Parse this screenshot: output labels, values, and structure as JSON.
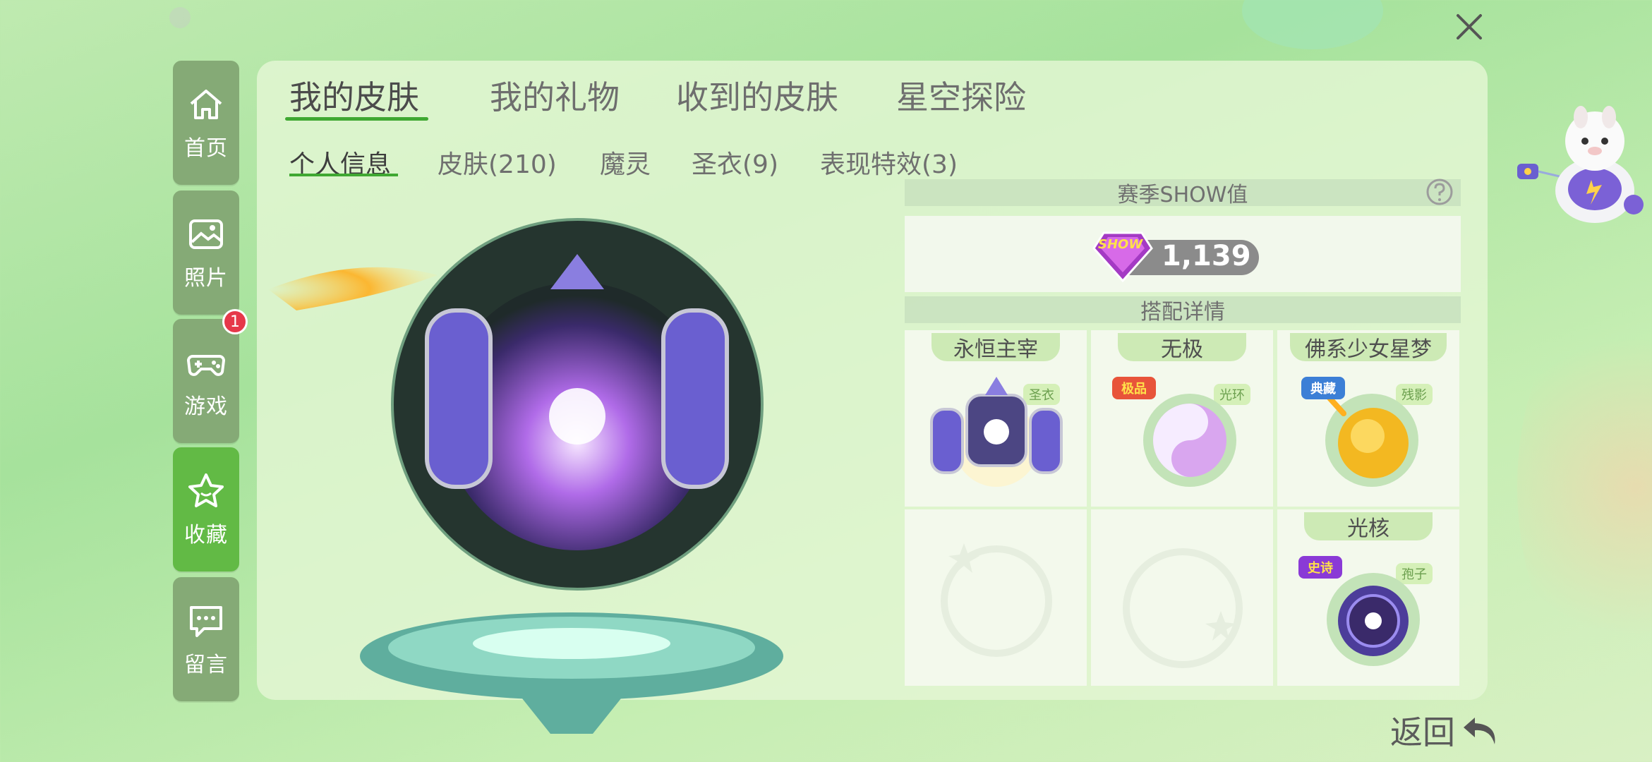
{
  "main_tabs": [
    {
      "label": "我的皮肤"
    },
    {
      "label": "我的礼物"
    },
    {
      "label": "收到的皮肤"
    },
    {
      "label": "星空探险"
    }
  ],
  "sub_tabs": [
    {
      "label": "个人信息"
    },
    {
      "label": "皮肤(210)"
    },
    {
      "label": "魔灵"
    },
    {
      "label": "圣衣(9)"
    },
    {
      "label": "表现特效(3)"
    }
  ],
  "sidebar": {
    "items": [
      {
        "label": "首页",
        "icon": "home-icon"
      },
      {
        "label": "照片",
        "icon": "photo-icon"
      },
      {
        "label": "游戏",
        "icon": "gamepad-icon",
        "badge": "1"
      },
      {
        "label": "收藏",
        "icon": "star-icon"
      },
      {
        "label": "留言",
        "icon": "message-icon"
      }
    ]
  },
  "show_section": {
    "title": "赛季SHOW值",
    "badge_text": "SHOW",
    "value": "1,139"
  },
  "outfit_section": {
    "title": "搭配详情",
    "items": [
      {
        "title": "永恒主宰",
        "tag": "圣衣"
      },
      {
        "title": "无极",
        "tag": "光环",
        "rarity": "极品"
      },
      {
        "title": "佛系少女星梦",
        "tag": "残影",
        "rarity": "典藏"
      },
      {
        "title": "光核",
        "tag": "孢子",
        "rarity": "史诗"
      }
    ]
  },
  "return_label": "返回",
  "colors": {
    "accent_green": "#3fa832",
    "sidebar_active": "#62ba45",
    "sidebar_inactive": "#85aa76",
    "badge_red": "#e6384a"
  }
}
